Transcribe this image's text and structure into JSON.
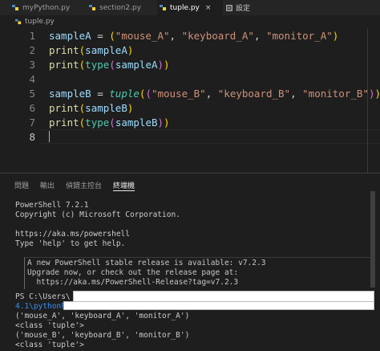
{
  "tabs": [
    {
      "label": "myPython.py",
      "active": false
    },
    {
      "label": "section2.py",
      "active": false
    },
    {
      "label": "tuple.py",
      "active": true
    }
  ],
  "tab_close_glyph": "×",
  "settings_tab": {
    "label": "設定"
  },
  "breadcrumb": {
    "file": "tuple.py"
  },
  "editor": {
    "line_numbers": [
      "1",
      "2",
      "3",
      "4",
      "5",
      "6",
      "7",
      "8"
    ],
    "lines": [
      [
        "sampleA",
        " = ",
        "(",
        "\"mouse_A\"",
        ", ",
        "\"keyboard_A\"",
        ", ",
        "\"monitor_A\"",
        ")"
      ],
      [
        "print",
        "(",
        "sampleA",
        ")"
      ],
      [
        "print",
        "(",
        "type",
        "(",
        "sampleA",
        ")",
        ")"
      ],
      [],
      [
        "sampleB",
        " = ",
        "tuple",
        "(",
        "(",
        "\"mouse_B\"",
        ", ",
        "\"keyboard_B\"",
        ", ",
        "\"monitor_B\"",
        ")",
        ")"
      ],
      [
        "print",
        "(",
        "sampleB",
        ")"
      ],
      [
        "print",
        "(",
        "type",
        "(",
        "sampleB",
        ")",
        ")"
      ],
      []
    ]
  },
  "panel": {
    "tabs": [
      "問題",
      "輸出",
      "偵錯主控台",
      "終端機"
    ],
    "active_tab": "終端機"
  },
  "terminal": {
    "header": [
      "PowerShell 7.2.1",
      "Copyright (c) Microsoft Corporation.",
      "",
      "https://aka.ms/powershell",
      "Type 'help' to get help."
    ],
    "notice": [
      "A new PowerShell stable release is available: v7.2.3",
      "Upgrade now, or check out the release page at:",
      "  https://aka.ms/PowerShell-Release?tag=v7.2.3"
    ],
    "prompt1": "PS C:\\Users\\",
    "prompt2": "4.1\\pythonF",
    "output": [
      "('mouse_A', 'keyboard_A', 'monitor_A')",
      "<class 'tuple'>",
      "('mouse_B', 'keyboard_B', 'monitor_B')",
      "<class 'tuple'>"
    ]
  },
  "colors": {
    "background": "#1e1e1e",
    "variable": "#9cdcfe",
    "string": "#ce9178",
    "function": "#dcdcaa",
    "bracket_level1": "#ffd700",
    "bracket_level2": "#da70d6",
    "builtin_type": "#4ec9b0"
  }
}
